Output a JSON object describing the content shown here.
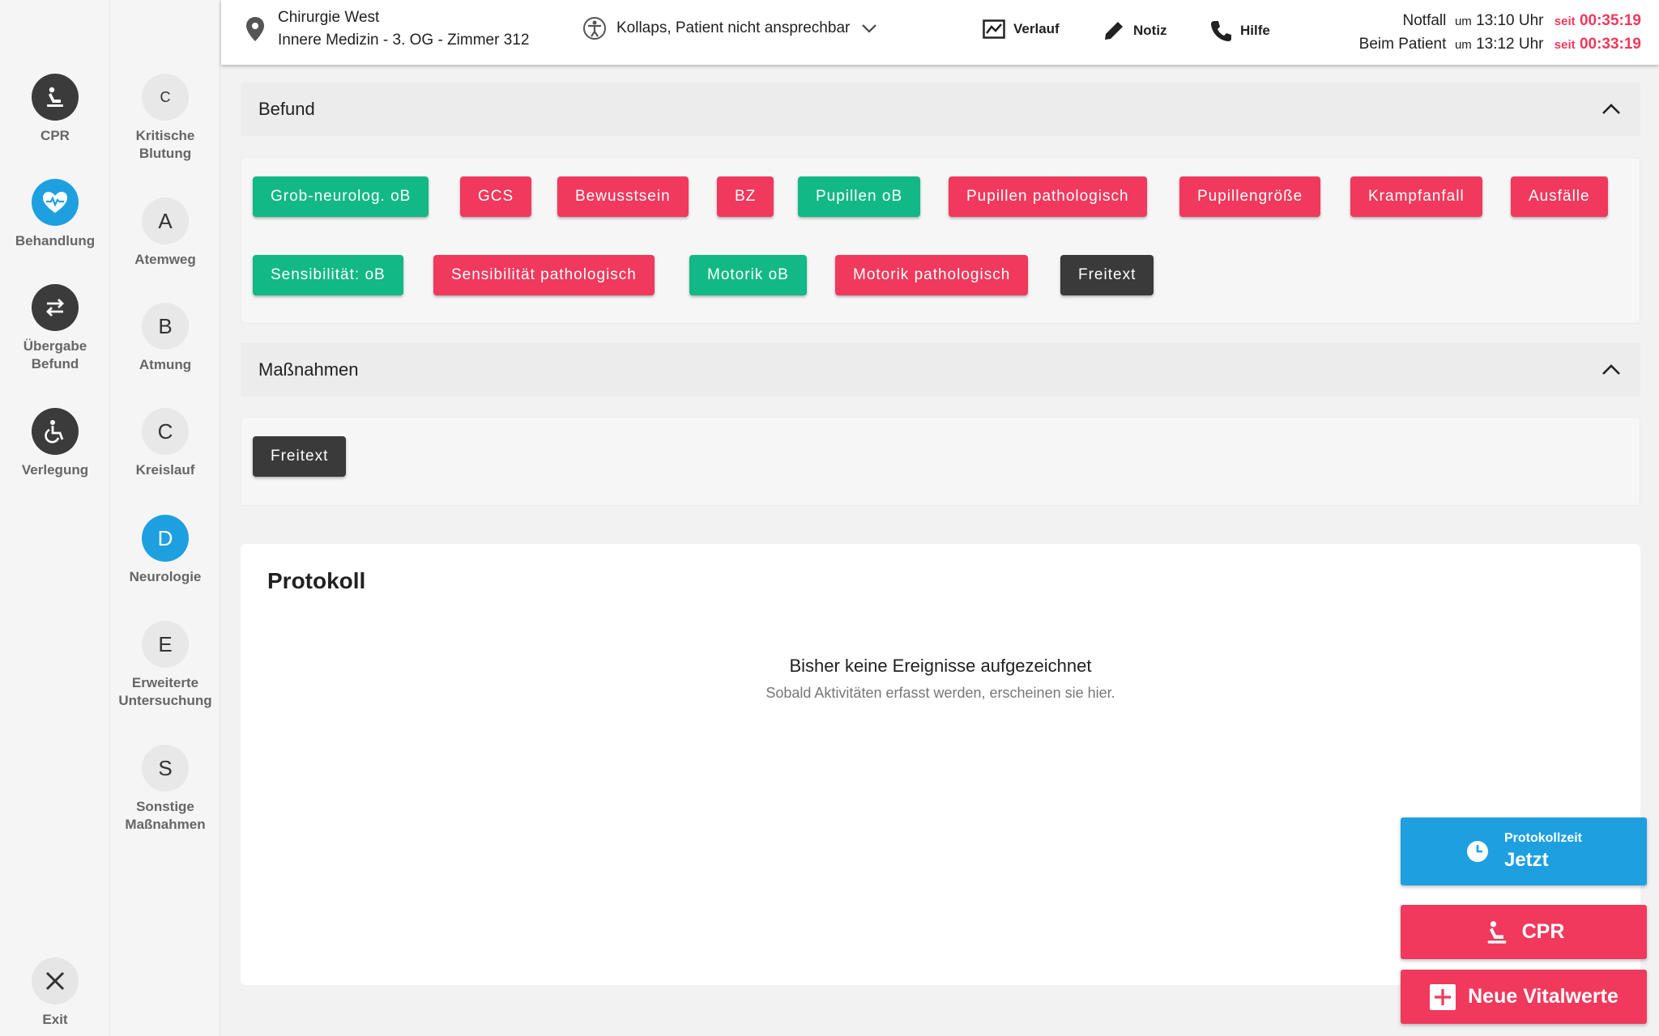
{
  "rail1": {
    "items": [
      {
        "label": "CPR",
        "icon": "cpr-icon"
      },
      {
        "label": "Behandlung",
        "icon": "heart-pulse-icon"
      },
      {
        "label": "Übergabe",
        "label2": "Befund",
        "icon": "swap-arrows-icon"
      },
      {
        "label": "Verlegung",
        "icon": "wheelchair-icon"
      }
    ],
    "exit_label": "Exit"
  },
  "rail2": {
    "items": [
      {
        "letter": "C",
        "label": "Kritische",
        "label2": "Blutung"
      },
      {
        "letter": "A",
        "label": "Atemweg"
      },
      {
        "letter": "B",
        "label": "Atmung"
      },
      {
        "letter": "C",
        "label": "Kreislauf"
      },
      {
        "letter": "D",
        "label": "Neurologie"
      },
      {
        "letter": "E",
        "label": "Erweiterte",
        "label2": "Untersuchung"
      },
      {
        "letter": "S",
        "label": "Sonstige",
        "label2": "Maßnahmen"
      }
    ]
  },
  "header": {
    "location_line1": "Chirurgie West",
    "location_line2": "Innere Medizin - 3. OG - Zimmer 312",
    "diagnosis": "Kollaps, Patient nicht ansprechbar",
    "actions": {
      "verlauf": "Verlauf",
      "notiz": "Notiz",
      "hilfe": "Hilfe"
    },
    "times": {
      "row1_label": "Notfall",
      "row1_um": "um",
      "row1_time": "13:10 Uhr",
      "row1_seit": "seit",
      "row1_elapsed": "00:35:19",
      "row2_label": "Beim Patient",
      "row2_um": "um",
      "row2_time": "13:12 Uhr",
      "row2_seit": "seit",
      "row2_elapsed": "00:33:19"
    }
  },
  "befund": {
    "title": "Befund",
    "chips_row1": [
      "Grob-neurolog. oB",
      "GCS",
      "Bewusstsein",
      "BZ",
      "Pupillen oB",
      "Pupillen pathologisch",
      "Pupillengröße",
      "Krampfanfall",
      "Ausfälle"
    ],
    "chips_row2": [
      "Sensibilität: oB",
      "Sensibilität pathologisch",
      "Motorik oB",
      "Motorik pathologisch",
      "Freitext"
    ]
  },
  "massnahmen": {
    "title": "Maßnahmen",
    "chips": [
      "Freitext"
    ]
  },
  "protokoll": {
    "title": "Protokoll",
    "empty_title": "Bisher keine Ereignisse aufgezeichnet",
    "empty_sub": "Sobald Aktivitäten erfasst werden, erscheinen sie hier."
  },
  "fabs": {
    "protokollzeit_label": "Protokollzeit",
    "protokollzeit_value": "Jetzt",
    "cpr": "CPR",
    "neue_vitalwerte": "Neue Vitalwerte"
  },
  "colors": {
    "green": "#12b886",
    "red": "#f0395c",
    "blue": "#1ea0e0",
    "dark": "#3a3a3a"
  }
}
